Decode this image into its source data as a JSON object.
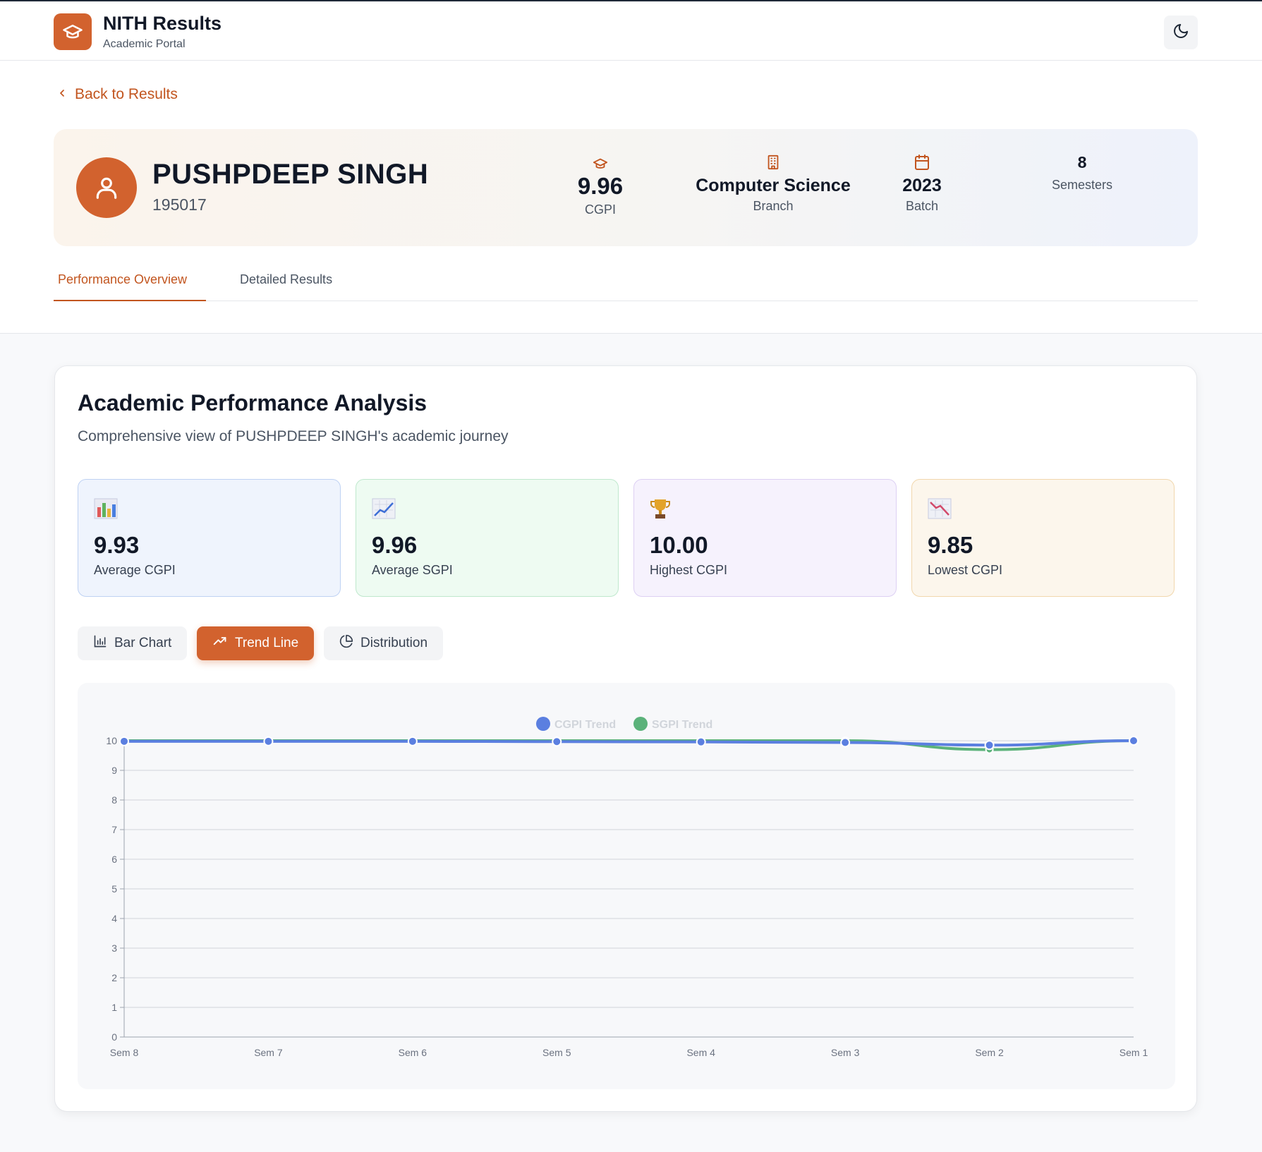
{
  "header": {
    "title": "NITH Results",
    "subtitle": "Academic Portal",
    "logo_icon": "graduation-cap-icon",
    "theme_icon": "moon-icon"
  },
  "nav": {
    "back_label": "Back to Results"
  },
  "student": {
    "name": "PUSHPDEEP SINGH",
    "roll": "195017",
    "stats": {
      "cgpi": {
        "value": "9.96",
        "label": "CGPI"
      },
      "branch": {
        "value": "Computer Science",
        "label": "Branch"
      },
      "batch": {
        "value": "2023",
        "label": "Batch"
      },
      "semesters": {
        "value": "8",
        "label": "Semesters"
      }
    }
  },
  "tabs": [
    {
      "label": "Performance Overview",
      "active": true
    },
    {
      "label": "Detailed Results",
      "active": false
    }
  ],
  "analysis": {
    "title": "Academic Performance Analysis",
    "description": "Comprehensive view of PUSHPDEEP SINGH's academic journey",
    "kpis": [
      {
        "icon": "bar-chart-emoji-icon",
        "value": "9.93",
        "label": "Average CGPI",
        "bg": "#eff4fd",
        "border": "#bfd2f3"
      },
      {
        "icon": "chart-increasing-emoji-icon",
        "value": "9.96",
        "label": "Average SGPI",
        "bg": "#eefbf2",
        "border": "#bfe8cd"
      },
      {
        "icon": "trophy-emoji-icon",
        "value": "10.00",
        "label": "Highest CGPI",
        "bg": "#f6f2fd",
        "border": "#ddd0f3"
      },
      {
        "icon": "chart-decreasing-emoji-icon",
        "value": "9.85",
        "label": "Lowest CGPI",
        "bg": "#fcf6ec",
        "border": "#f1d7ad"
      }
    ],
    "chart_toggles": [
      {
        "label": "Bar Chart",
        "icon": "bar-chart-icon",
        "active": false
      },
      {
        "label": "Trend Line",
        "icon": "trending-up-icon",
        "active": true
      },
      {
        "label": "Distribution",
        "icon": "pie-chart-icon",
        "active": false
      }
    ]
  },
  "colors": {
    "accent": "#d2622e",
    "cgpi": "#5b7fe0",
    "sgpi": "#5bb27a"
  },
  "chart_data": {
    "type": "line",
    "categories": [
      "Sem 8",
      "Sem 7",
      "Sem 6",
      "Sem 5",
      "Sem 4",
      "Sem 3",
      "Sem 2",
      "Sem 1"
    ],
    "series": [
      {
        "name": "CGPI Trend",
        "values": [
          9.98,
          9.98,
          9.98,
          9.97,
          9.96,
          9.94,
          9.85,
          10.0
        ]
      },
      {
        "name": "SGPI Trend",
        "values": [
          10.0,
          10.0,
          10.0,
          10.0,
          10.0,
          10.0,
          9.7,
          10.0
        ]
      }
    ],
    "ylim": [
      0,
      10
    ],
    "yticks": [
      0,
      1,
      2,
      3,
      4,
      5,
      6,
      7,
      8,
      9,
      10
    ],
    "legend": "top-center",
    "grid": true
  }
}
